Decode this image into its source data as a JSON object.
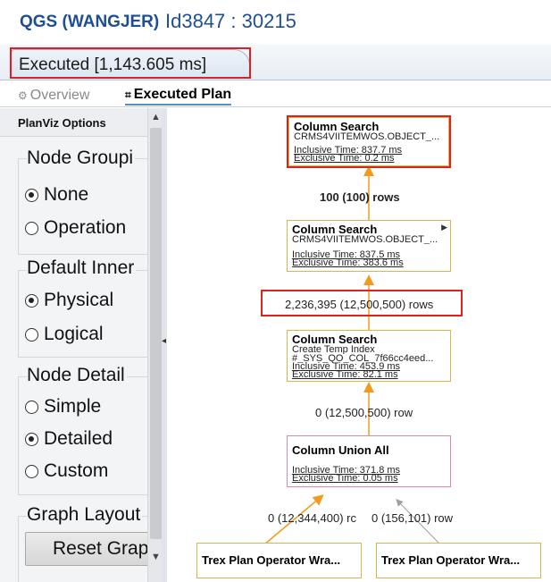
{
  "title": {
    "app_name": "QGS (WANGJER)",
    "session_id": "Id3847 : 30215"
  },
  "executed_tab": {
    "label": "Executed [1,143.605 ms]"
  },
  "subtabs": [
    {
      "label": "Overview",
      "icon": "gear-icon",
      "active": false
    },
    {
      "label": "Executed Plan",
      "icon": "plan-icon",
      "active": true
    }
  ],
  "options_panel": {
    "title": "PlanViz Options",
    "groups": [
      {
        "label": "Node Groupi",
        "options": [
          {
            "label": "None",
            "checked": true
          },
          {
            "label": "Operation",
            "checked": false
          }
        ]
      },
      {
        "label": "Default Inner",
        "options": [
          {
            "label": "Physical",
            "checked": true
          },
          {
            "label": "Logical",
            "checked": false
          }
        ]
      },
      {
        "label": "Node Detail",
        "options": [
          {
            "label": "Simple",
            "checked": false
          },
          {
            "label": "Detailed",
            "checked": true
          },
          {
            "label": "Custom",
            "checked": false
          }
        ]
      },
      {
        "label": "Graph Layout"
      }
    ],
    "reset_button": "Reset Grap"
  },
  "plan": {
    "nodes": [
      {
        "title": "Column Search",
        "subtitle": "CRMS4VIITEMWOS.OBJECT_...",
        "inclusive": "Inclusive Time: 837.7 ms",
        "exclusive": "Exclusive Time: 0.2 ms"
      },
      {
        "title": "Column Search",
        "subtitle": "CRMS4VIITEMWOS.OBJECT_...",
        "inclusive": "Inclusive Time: 837.5 ms",
        "exclusive": "Exclusive Time: 383.6 ms"
      },
      {
        "title": "Column Search",
        "subtitle": "Create Temp Index",
        "subtitle2": "#_SYS_QO_COL_7f66cc4eed...",
        "inclusive": "Inclusive Time: 453.9 ms",
        "exclusive": "Exclusive Time: 82.1 ms"
      },
      {
        "title": "Column Union All",
        "inclusive": "Inclusive Time: 371.8 ms",
        "exclusive": "Exclusive Time: 0.05 ms"
      },
      {
        "title": "Trex Plan Operator Wra..."
      },
      {
        "title": "Trex Plan Operator Wra..."
      }
    ],
    "row_labels": {
      "r1": "100 (100) rows",
      "r2": "2,236,395 (12,500,500) rows",
      "r3": "0 (12,500,500) row",
      "r4a": "0 (12,344,400) rc",
      "r4b": "0 (156,101) row"
    },
    "edge_color_orange": "#f39a1e",
    "edge_color_gray": "#9aa0a6",
    "highlight_color": "#e02020"
  }
}
